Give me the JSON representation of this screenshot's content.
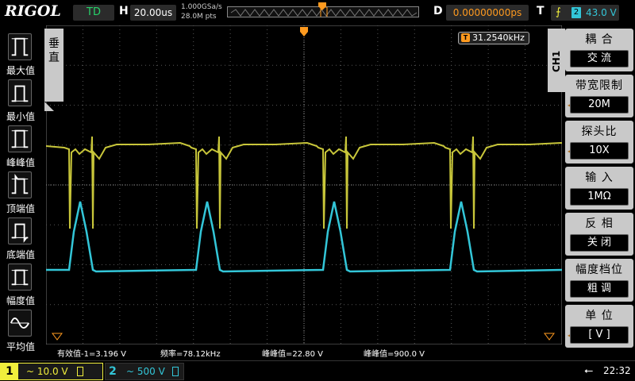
{
  "topbar": {
    "logo": "RIGOL",
    "run_state": "TD",
    "timebase_label": "H",
    "timebase_value": "20.00us",
    "sample_rate": "1.000GSa/s",
    "memory_depth": "28.0M pts",
    "delay_label": "D",
    "delay_value": "0.00000000ps",
    "trigger_label": "T",
    "trigger_edge": "rising-edge-icon",
    "trigger_source": "2",
    "trigger_level": "43.0 V"
  },
  "left_menu": {
    "tab_label": "垂直",
    "items": [
      {
        "label": "最大值",
        "icon": "max-value-icon"
      },
      {
        "label": "最小值",
        "icon": "min-value-icon"
      },
      {
        "label": "峰峰值",
        "icon": "peak-to-peak-icon"
      },
      {
        "label": "顶端值",
        "icon": "top-value-icon"
      },
      {
        "label": "底端值",
        "icon": "base-value-icon"
      },
      {
        "label": "幅度值",
        "icon": "amplitude-icon"
      },
      {
        "label": "平均值",
        "icon": "average-icon"
      }
    ]
  },
  "frequency_counter": {
    "badge": "T",
    "value": "31.2540kHz"
  },
  "right_menu": {
    "channel_tab": "CH1",
    "items": [
      {
        "title": "耦 合",
        "value": "交 流",
        "has_arrow": false
      },
      {
        "title": "带宽限制",
        "value": "20M",
        "has_arrow": true
      },
      {
        "title": "探头比",
        "value": "10X",
        "has_arrow": true
      },
      {
        "title": "输 入",
        "value": "1MΩ",
        "has_arrow": false
      },
      {
        "title": "反 相",
        "value": "关 闭",
        "has_arrow": false
      },
      {
        "title": "幅度档位",
        "value": "粗 调",
        "has_arrow": false
      },
      {
        "title": "单 位",
        "value": "[ V ]",
        "has_arrow": true
      }
    ]
  },
  "measurements": [
    "有效值-1=3.196 V",
    "频率=78.12kHz",
    "峰峰值=22.80 V",
    "峰峰值=900.0 V"
  ],
  "bottombar": {
    "ch1_number": "1",
    "ch1_scale": "~ 10.0 V",
    "ch2_number": "2",
    "ch2_scale": "~ 500 V",
    "clock": "22:32"
  },
  "colors": {
    "ch1": "#f0ee3c",
    "ch1_trace": "#c8c63a",
    "ch2": "#33c6d8",
    "trigger": "#ff9a1f"
  }
}
